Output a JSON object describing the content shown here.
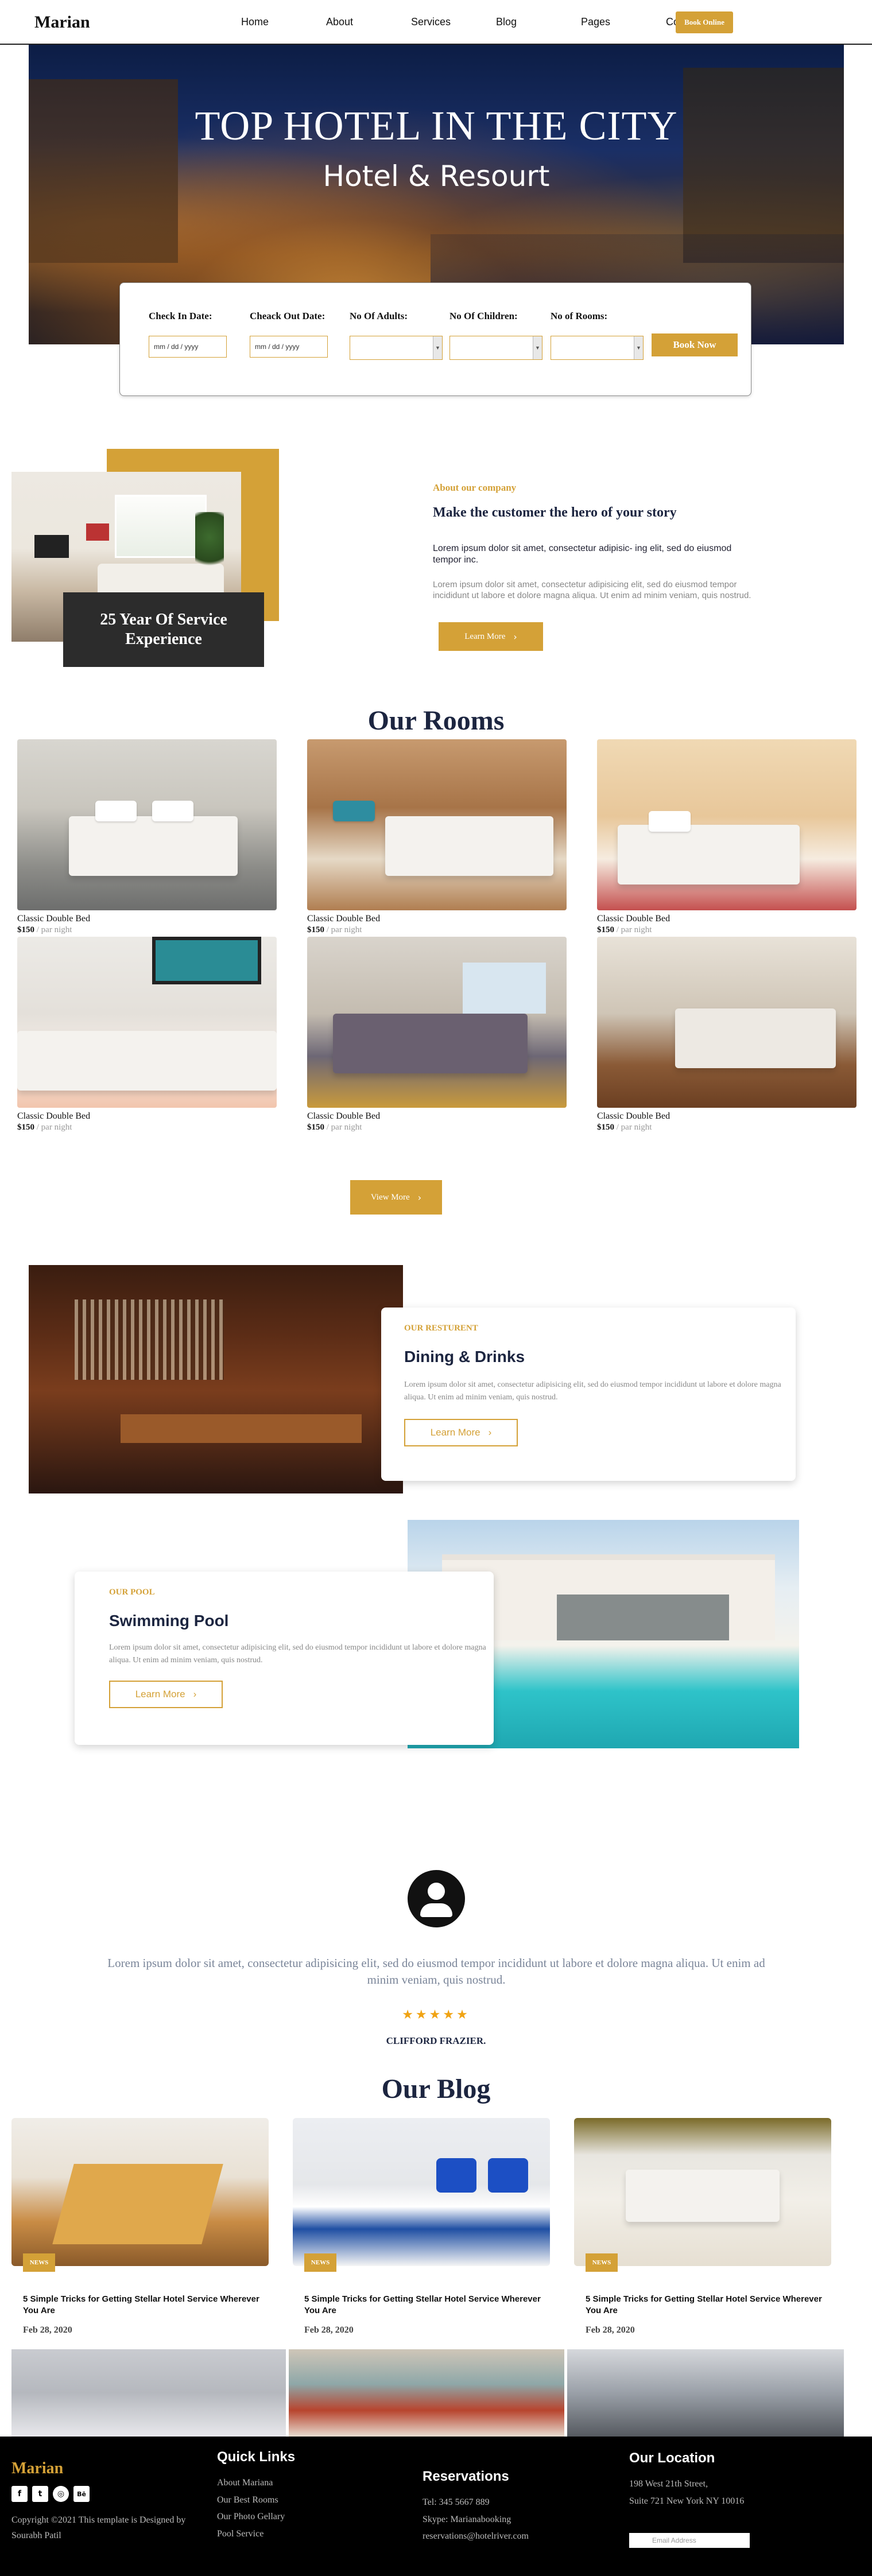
{
  "nav": {
    "brand": "Marian",
    "links": [
      "Home",
      "About",
      "Services",
      "Blog",
      "Pages",
      "Contact"
    ],
    "cta": "Book Online"
  },
  "hero": {
    "title": "TOP HOTEL IN THE CITY",
    "subtitle": "Hotel & Resourt"
  },
  "booking": {
    "checkin_label": "Check In Date:",
    "checkout_label": "Cheack Out Date:",
    "adults_label": "No Of Adults:",
    "children_label": "No Of Children:",
    "rooms_label": "No of Rooms:",
    "date_placeholder": "mm / dd / yyyy",
    "button": "Book Now"
  },
  "about": {
    "badge": "25 Year Of Service Experience",
    "kicker": "About our company",
    "heading": "Make the customer the hero of your story",
    "p1": "Lorem ipsum dolor sit amet, consectetur adipisic- ing elit, sed do eiusmod tempor inc.",
    "p2": "Lorem ipsum dolor sit amet, consectetur adipisicing elit, sed do eiusmod tempor incididunt ut labore et dolore magna aliqua. Ut enim ad minim veniam, quis nostrud.",
    "button": "Learn More"
  },
  "rooms": {
    "title": "Our Rooms",
    "items": [
      {
        "name": "Classic Double Bed",
        "price": "$150",
        "per": " / par night"
      },
      {
        "name": "Classic Double Bed",
        "price": "$150",
        "per": " / par night"
      },
      {
        "name": "Classic Double Bed",
        "price": "$150",
        "per": " / par night"
      },
      {
        "name": "Classic Double Bed",
        "price": "$150",
        "per": " / par night"
      },
      {
        "name": "Classic Double Bed",
        "price": "$150",
        "per": " / par night"
      },
      {
        "name": "Classic Double Bed",
        "price": "$150",
        "per": " / par night"
      }
    ],
    "view_more": "View More"
  },
  "restaurant": {
    "kicker": "OUR RESTURENT",
    "title": "Dining & Drinks",
    "text": "Lorem ipsum dolor sit amet, consectetur adipisicing elit, sed do eiusmod tempor incididunt ut labore et dolore magna aliqua. Ut enim ad minim veniam, quis nostrud.",
    "button": "Learn More"
  },
  "pool": {
    "kicker": "OUR POOL",
    "title": "Swimming Pool",
    "text": "Lorem ipsum dolor sit amet, consectetur adipisicing elit, sed do eiusmod tempor incididunt ut labore et dolore magna aliqua. Ut enim ad minim veniam, quis nostrud.",
    "button": "Learn More"
  },
  "testimonial": {
    "quote": "Lorem ipsum dolor sit amet, consectetur adipisicing elit, sed do eiusmod tempor incididunt ut labore et dolore magna aliqua. Ut enim ad minim veniam, quis nostrud.",
    "stars": "★★★★★",
    "rating": 5,
    "author": "CLIFFORD FRAZIER."
  },
  "blog": {
    "title": "Our Blog",
    "posts": [
      {
        "tag": "NEWS",
        "title": "5 Simple Tricks for Getting Stellar Hotel Service Wherever You Are",
        "date": "Feb 28, 2020"
      },
      {
        "tag": "NEWS",
        "title": "5 Simple Tricks for Getting Stellar Hotel Service Wherever You Are",
        "date": "Feb 28, 2020"
      },
      {
        "tag": "NEWS",
        "title": "5 Simple Tricks for Getting Stellar Hotel Service Wherever You Are",
        "date": "Feb 28, 2020"
      }
    ]
  },
  "footer": {
    "brand": "Marian",
    "social": [
      "facebook-icon",
      "twitter-icon",
      "globe-icon",
      "behance-icon"
    ],
    "copyright": "Copyright ©2021 This template is Designed by Sourabh Patil",
    "quick_links_title": "Quick Links",
    "quick_links": [
      "About Mariana",
      "Our Best Rooms",
      "Our Photo Gellary",
      "Pool Service"
    ],
    "reservations_title": "Reservations",
    "reservations": [
      "Tel: 345 5667 889",
      "Skype: Marianabooking",
      "reservations@hotelriver.com"
    ],
    "location_title": "Our Location",
    "location": [
      "198 West 21th Street,",
      "Suite 721 New York NY 10016"
    ],
    "email_placeholder": "Email Address"
  },
  "colors": {
    "accent": "#d4a137",
    "heading": "#1c2540",
    "footer_bg": "#000000"
  }
}
